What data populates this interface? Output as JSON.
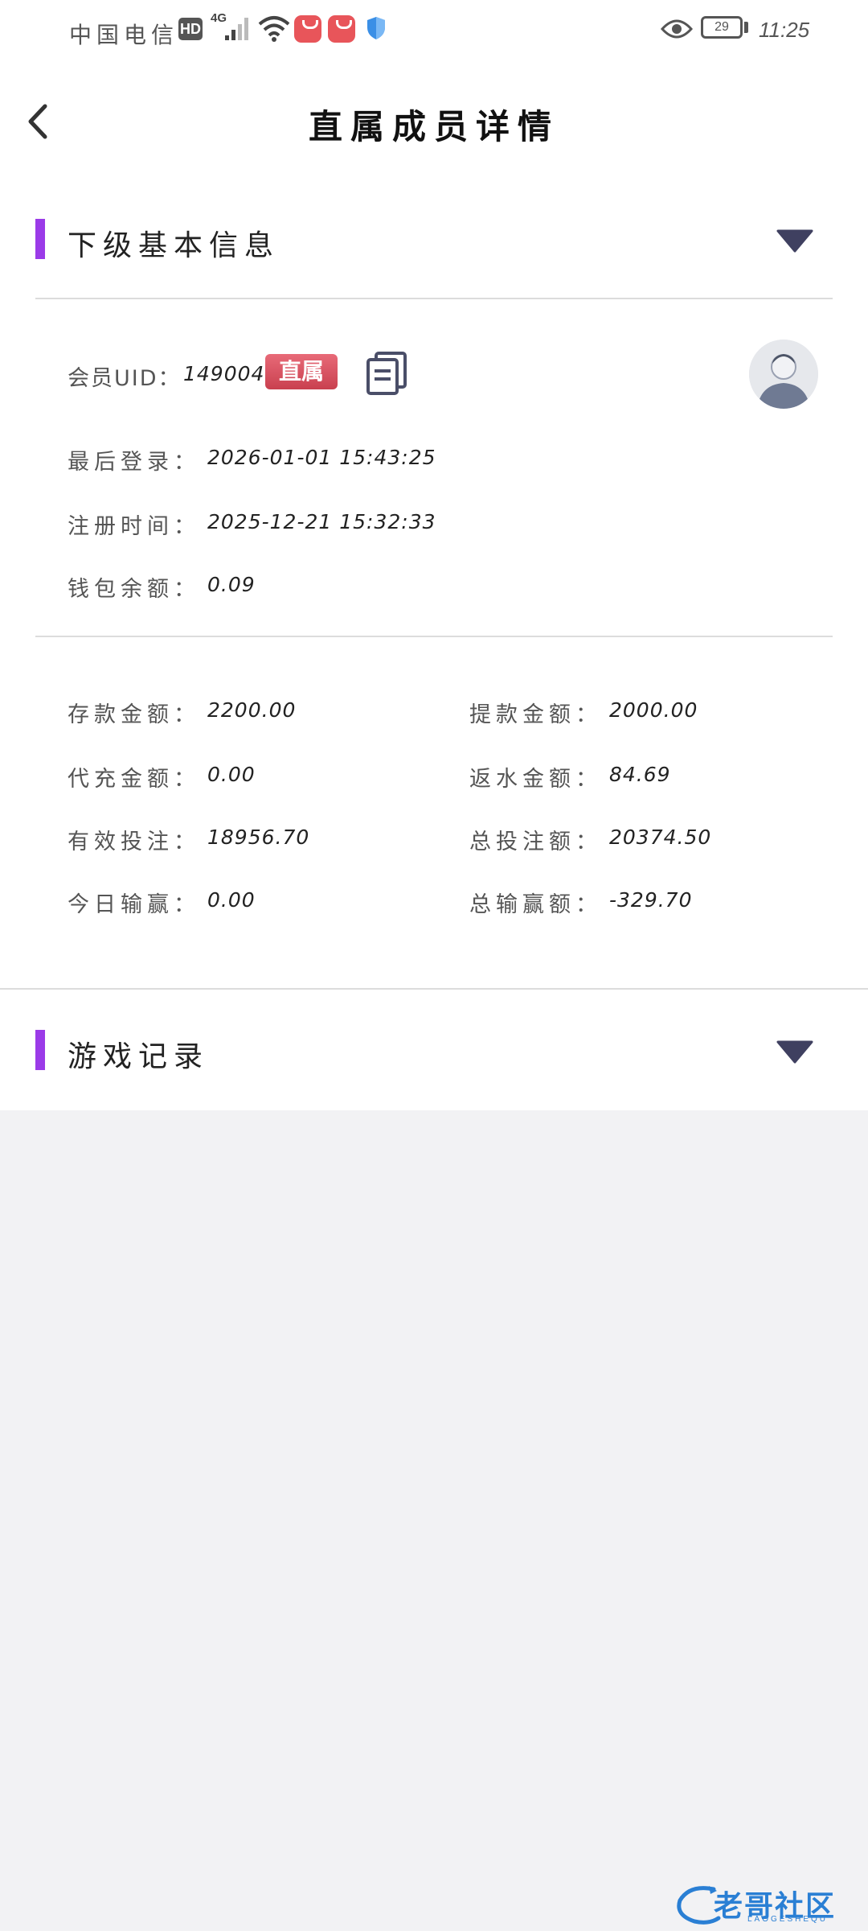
{
  "status_bar": {
    "carrier": "中国电信",
    "hd": "HD",
    "network": "4G",
    "battery": "29",
    "time": "11:25",
    "icons": [
      "signal-icon",
      "wifi-icon",
      "app-icon",
      "app-icon",
      "shield-icon",
      "eye-icon",
      "battery-icon"
    ]
  },
  "header": {
    "title": "直属成员详情",
    "back_icon": "chevron-left-icon"
  },
  "basic_info": {
    "title": "下级基本信息",
    "toggle_icon": "triangle-down-icon",
    "uid_label": "会员UID：",
    "uid_value": "1490041",
    "badge": "直属",
    "copy_icon": "copy-icon",
    "avatar_icon": "user-avatar-icon",
    "last_login_label": "最后登录：",
    "last_login_value": "2026-01-01  15:43:25",
    "register_label": "注册时间：",
    "register_value": "2025-12-21  15:32:33",
    "wallet_label": "钱包余额：",
    "wallet_value": "0.09"
  },
  "stats": [
    {
      "label": "存款金额：",
      "value": "2200.00"
    },
    {
      "label": "提款金额：",
      "value": "2000.00"
    },
    {
      "label": "代充金额：",
      "value": "0.00"
    },
    {
      "label": "返水金额：",
      "value": "84.69"
    },
    {
      "label": "有效投注：",
      "value": "18956.70"
    },
    {
      "label": "总投注额：",
      "value": "20374.50"
    },
    {
      "label": "今日输赢：",
      "value": "0.00"
    },
    {
      "label": "总输赢额：",
      "value": "-329.70"
    }
  ],
  "game_records": {
    "title": "游戏记录",
    "toggle_icon": "triangle-down-icon"
  },
  "colors": {
    "accent": "#9b3be8",
    "badge": "#d24b5a",
    "toggle": "#3f4060",
    "background": "#f2f2f4"
  },
  "watermark": {
    "text": "老哥社区",
    "sub": "LAOGESHEQU"
  }
}
